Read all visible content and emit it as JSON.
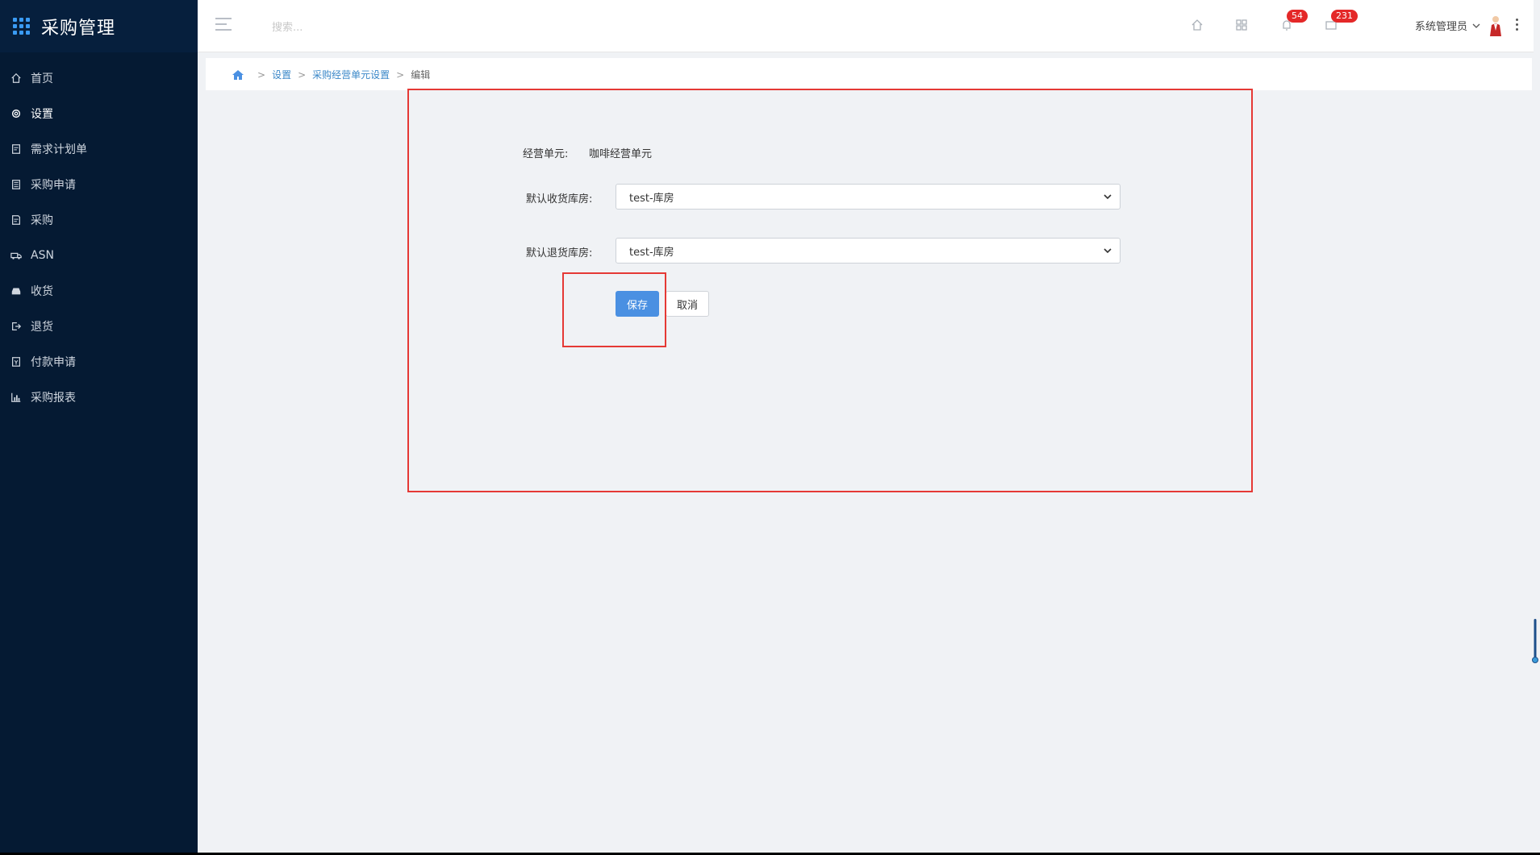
{
  "app": {
    "title": "采购管理"
  },
  "sidebar": {
    "items": [
      {
        "label": "首页",
        "icon": "home-icon"
      },
      {
        "label": "设置",
        "icon": "gear-icon",
        "active": true
      },
      {
        "label": "需求计划单",
        "icon": "document-edit-icon"
      },
      {
        "label": "采购申请",
        "icon": "document-icon"
      },
      {
        "label": "采购",
        "icon": "receipt-icon"
      },
      {
        "label": "ASN",
        "icon": "truck-icon"
      },
      {
        "label": "收货",
        "icon": "inbox-icon"
      },
      {
        "label": "退货",
        "icon": "return-icon"
      },
      {
        "label": "付款申请",
        "icon": "payment-icon"
      },
      {
        "label": "采购报表",
        "icon": "bar-chart-icon"
      }
    ]
  },
  "header": {
    "search_placeholder": "搜索...",
    "notifications_count": "54",
    "messages_count": "231",
    "user_name": "系统管理员"
  },
  "breadcrumb": {
    "items": [
      "设置",
      "采购经营单元设置"
    ],
    "current": "编辑"
  },
  "form": {
    "unit_label": "经营单元:",
    "unit_value": "咖啡经营单元",
    "receive_label": "默认收货库房:",
    "receive_value": "test-库房",
    "return_label": "默认退货库房:",
    "return_value": "test-库房",
    "save_label": "保存",
    "cancel_label": "取消"
  },
  "colors": {
    "sidebar_bg": "#051a33",
    "accent": "#4a90e2",
    "badge": "#e42828",
    "annotation": "#e53935"
  }
}
